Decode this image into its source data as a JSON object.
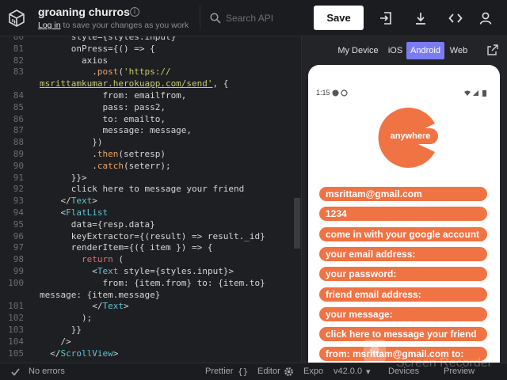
{
  "header": {
    "project_title": "groaning churros",
    "info_icon": "info-icon",
    "subtitle_link": "Log in",
    "subtitle_rest": " to save your changes as you work",
    "search_placeholder": "Search API",
    "save_label": "Save",
    "icons": [
      "import-icon",
      "download-icon",
      "code-icon",
      "user-icon"
    ]
  },
  "editor": {
    "lines": [
      {
        "n": "80",
        "code": "      style={styles.input}"
      },
      {
        "n": "81",
        "code": "      onPress={() => {"
      },
      {
        "n": "82",
        "code": "        axios"
      },
      {
        "n": "83",
        "code": "          .post('https://"
      },
      {
        "n": "",
        "code": "msrittamkumar.herokuapp.com/send', {"
      },
      {
        "n": "84",
        "code": "            from: emailfrom,"
      },
      {
        "n": "85",
        "code": "            pass: pass2,"
      },
      {
        "n": "86",
        "code": "            to: emailto,"
      },
      {
        "n": "87",
        "code": "            message: message,"
      },
      {
        "n": "88",
        "code": "          })"
      },
      {
        "n": "89",
        "code": "          .then(setresp)"
      },
      {
        "n": "90",
        "code": "          .catch(seterr);"
      },
      {
        "n": "91",
        "code": "      }}>"
      },
      {
        "n": "92",
        "code": "      click here to message your friend"
      },
      {
        "n": "93",
        "code": "    </Text>"
      },
      {
        "n": "94",
        "code": "    <FlatList"
      },
      {
        "n": "95",
        "code": "      data={resp.data}"
      },
      {
        "n": "96",
        "code": "      keyExtractor={(result) => result._id}"
      },
      {
        "n": "97",
        "code": "      renderItem={({ item }) => {"
      },
      {
        "n": "98",
        "code": "        return ("
      },
      {
        "n": "99",
        "code": "          <Text style={styles.input}>"
      },
      {
        "n": "100",
        "code": "            from: {item.from} to: {item.to}"
      },
      {
        "n": "",
        "code": "message: {item.message}"
      },
      {
        "n": "101",
        "code": "          </Text>"
      },
      {
        "n": "102",
        "code": "        );"
      },
      {
        "n": "103",
        "code": "      }}"
      },
      {
        "n": "104",
        "code": "    />"
      },
      {
        "n": "105",
        "code": "  </ScrollView>"
      }
    ]
  },
  "preview": {
    "tabs": [
      "My Device",
      "iOS",
      "Android",
      "Web"
    ],
    "active_tab": "Android",
    "status_time": "1:15",
    "logo_text": "anywhere",
    "brand_color": "#f07344",
    "accent_color": "#7b7cf2",
    "fields": [
      "msrittam@gmail.com",
      "1234",
      "come in with your google account",
      "your email address:",
      "your password:",
      "friend email address:",
      "your message:",
      "click here to message your friend",
      "from: msrittam@gmail.com to:"
    ]
  },
  "footer": {
    "status": "No errors",
    "prettier": "Prettier",
    "editor": "Editor",
    "expo": "Expo",
    "version": "v42.0.0",
    "devices": "Devices",
    "preview": "Preview"
  },
  "watermark": {
    "line1": "Screen Recorder"
  }
}
